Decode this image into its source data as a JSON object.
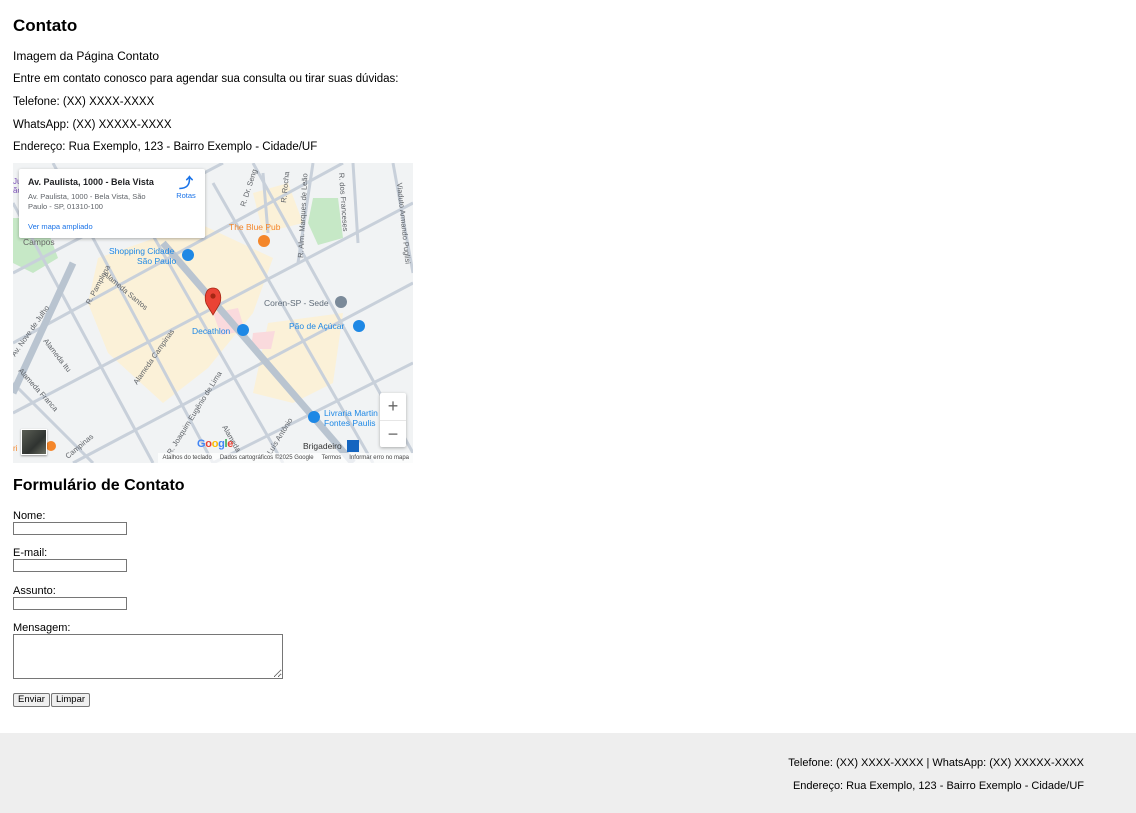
{
  "page": {
    "title": "Contato",
    "image_alt": "Imagem da Página Contato",
    "intro": "Entre em contato conosco para agendar sua consulta ou tirar suas dúvidas:",
    "phone": "Telefone: (XX) XXXX-XXXX",
    "whatsapp": "WhatsApp: (XX) XXXXX-XXXX",
    "address": "Endereço: Rua Exemplo, 123 - Bairro Exemplo - Cidade/UF"
  },
  "map": {
    "card_title": "Av. Paulista, 1000 - Bela Vista",
    "card_address": "Av. Paulista, 1000 - Bela Vista, São Paulo - SP, 01310-100",
    "directions_label": "Rotas",
    "larger_map_link": "Ver mapa ampliado",
    "zoom_in": "+",
    "zoom_out": "−",
    "google_logo": [
      "G",
      "o",
      "o",
      "g",
      "l",
      "e"
    ],
    "attribution": {
      "shortcuts": "Atalhos do teclado",
      "data": "Dados cartográficos ©2025 Google",
      "terms": "Termos",
      "report": "Informar erro no mapa"
    },
    "labels": {
      "blue_pub": "The Blue Pub",
      "shopping_1": "Shopping Cidade",
      "shopping_2": "São Paulo",
      "coren": "Coren-SP - Sede",
      "decathlon": "Decathlon",
      "pao": "Pão de Açúcar",
      "livraria_1": "Livraria Martin",
      "livraria_2": "Fontes Paulis",
      "brigadeiro": "Brigadeiro",
      "campos": "Campos",
      "streets": {
        "dr_seng": "R. Dr. Seng",
        "rocha": "R. Rocha",
        "leao": "R. Alm. Marques de Leão",
        "franceses": "R. dos Franceses",
        "viaduto": "Viaduto Armando Puglisi",
        "alameda_santos": "Alameda Santos",
        "pamplona": "R. Pamplona",
        "nove_julho": "Av. Nove de Julho",
        "itu": "Alameda Itu",
        "franca": "Alameda Franca",
        "campinas": "Alameda Campinas",
        "campinas_2": "Campinas",
        "eugenio": "R. Joaquim Eugênio de Lima",
        "luis_antonio": "Luís Antônio",
        "alameda": "Alameda",
        "frag_1": "Ju",
        "frag_2": "ão",
        "frag_3": "ri"
      }
    }
  },
  "form": {
    "title": "Formulário de Contato",
    "name_label": "Nome:",
    "email_label": "E-mail:",
    "subject_label": "Assunto:",
    "message_label": "Mensagem:",
    "name_value": "",
    "email_value": "",
    "subject_value": "",
    "message_value": "",
    "submit_label": "Enviar",
    "reset_label": "Limpar"
  },
  "footer": {
    "contact_line": "Telefone: (XX) XXXX-XXXX | WhatsApp: (XX) XXXXX-XXXX",
    "address_line": "Endereço: Rua Exemplo, 123 - Bairro Exemplo - Cidade/UF"
  },
  "colors": {
    "map_bg": "#f1f3f4",
    "road": "#c8d0da",
    "avenue": "#b9c4d0",
    "park": "#c6e8c6",
    "commercial": "#fbf1d8",
    "pin": "#ea4335",
    "poi_blue": "#1e88e5",
    "poi_orange": "#f4862a",
    "poi_gray": "#7b8a99",
    "footer_bg": "#eeeeee"
  }
}
